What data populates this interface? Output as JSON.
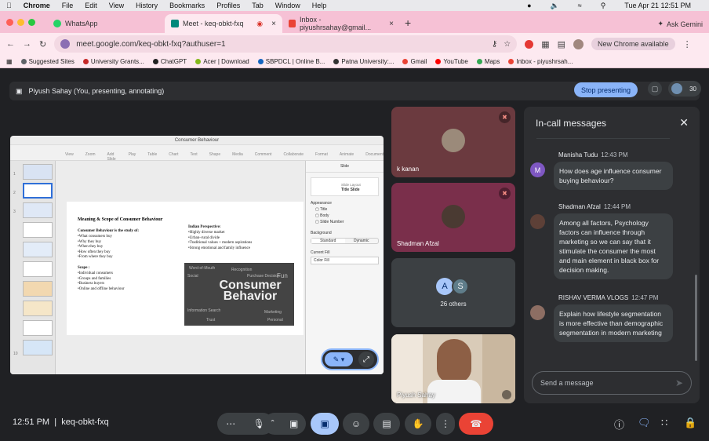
{
  "macmenu": {
    "app": "Chrome",
    "items": [
      "File",
      "Edit",
      "View",
      "History",
      "Bookmarks",
      "Profiles",
      "Tab",
      "Window",
      "Help"
    ],
    "datetime": "Tue Apr 21  12:51 PM"
  },
  "tabs": [
    {
      "label": "WhatsApp",
      "color": "#25d366"
    },
    {
      "label": "Meet - keq-obkt-fxq",
      "color": "#00897b"
    },
    {
      "label": "Inbox - piyushrsahay@gmail...",
      "color": "#ea4335"
    }
  ],
  "toolbar": {
    "url": "meet.google.com/keq-obkt-fxq?authuser=1",
    "new_chrome": "New Chrome available",
    "ask_gemini": "Ask Gemini"
  },
  "bookmarks": [
    "Suggested Sites",
    "University Grants...",
    "ChatGPT",
    "Acer | Download",
    "SBPDCL | Online B...",
    "Patna University:...",
    "Gmail",
    "YouTube",
    "Maps",
    "Inbox - piyushrsah..."
  ],
  "presenting": {
    "label": "Piyush Sahay (You, presenting, annotating)",
    "stop": "Stop presenting",
    "count": "30"
  },
  "slide": {
    "app_title": "Consumer Behaviour",
    "heading": "Meaning & Scope of Consumer Behaviour",
    "intro": "Consumer Behaviour is the study of:",
    "points": [
      "•What consumers buy",
      "•Why they buy",
      "•When they buy",
      "•How often they buy",
      "•From where they buy"
    ],
    "scope_title": "Scope :",
    "scope": [
      "•Individual consumers",
      "•Groups and families",
      "•Business buyers",
      "•Online and offline behaviour"
    ],
    "indian_title": "Indian Perspective:",
    "indian": [
      "•Highly diverse market",
      "•Urban–rural divide",
      "•Traditional values + modern aspirations",
      "•Strong emotional and family influence"
    ],
    "img_big": "Consumer Behavior",
    "img_words": [
      "Word-of-Mouth",
      "Social",
      "Information Search",
      "Trust",
      "Personal",
      "Marketing",
      "Fun",
      "Recognition",
      "Purchase Decision"
    ],
    "panel": {
      "tab": "Slide",
      "layout": "Slide Layout",
      "layout_name": "Title Slide",
      "appearance": "Appearance",
      "options": [
        "Title",
        "Body",
        "Slide Number"
      ],
      "background": "Background",
      "btn_standard": "Standard",
      "btn_dynamic": "Dynamic",
      "current_fill": "Current Fill",
      "color_fill": "Color Fill"
    }
  },
  "participants": [
    {
      "name": "k kanan"
    },
    {
      "name": "Shadman Afzal"
    },
    {
      "name": "26 others",
      "avatars": [
        "A",
        "S"
      ]
    },
    {
      "name": "Piyush Sahay"
    }
  ],
  "chat": {
    "title": "In-call messages",
    "messages": [
      {
        "sender": "Manisha Tudu",
        "time": "12:43 PM",
        "initial": "M",
        "text": "How does age influence consumer buying behaviour?"
      },
      {
        "sender": "Shadman Afzal",
        "time": "12:44 PM",
        "initial": "S",
        "text": "Among all factors, Psychology factors can influence through marketing so we can say that it stimulate the consumer the most and main element in black box for decision making."
      },
      {
        "sender": "RISHAV VERMA VLOGS",
        "time": "12:47 PM",
        "initial": "R",
        "text": "Explain how lifestyle segmentation is more effective than demographic segmentation in modern marketing"
      }
    ],
    "placeholder": "Send a message"
  },
  "footer": {
    "time": "12:51 PM",
    "code": "keq-obkt-fxq"
  }
}
